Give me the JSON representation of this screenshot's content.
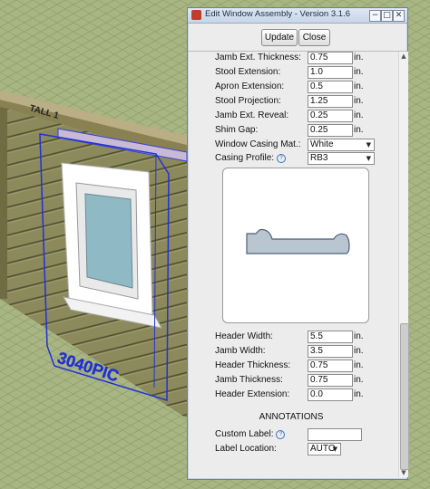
{
  "scene": {
    "model_label": "3040PIC",
    "wall_label": "TALL 1"
  },
  "dialog": {
    "title": "Edit Window Assembly - Version 3.1.6",
    "minimize": "−",
    "maximize": "□",
    "close": "✕",
    "update_label": "Update",
    "close_label": "Close"
  },
  "fields_top": [
    {
      "label": "Jamb Ext. Thickness:",
      "value": "0.75",
      "unit": "in."
    },
    {
      "label": "Stool Extension:",
      "value": "1.0",
      "unit": "in."
    },
    {
      "label": "Apron Extension:",
      "value": "0.5",
      "unit": "in."
    },
    {
      "label": "Stool Projection:",
      "value": "1.25",
      "unit": "in."
    },
    {
      "label": "Jamb Ext. Reveal:",
      "value": "0.25",
      "unit": "in."
    },
    {
      "label": "Shim Gap:",
      "value": "0.25",
      "unit": "in."
    }
  ],
  "casing_material": {
    "label": "Window Casing Mat.:",
    "value": "White"
  },
  "casing_profile": {
    "label": "Casing Profile:",
    "value": "RB3"
  },
  "fields_bottom": [
    {
      "label": "Header Width:",
      "value": "5.5",
      "unit": "in."
    },
    {
      "label": "Jamb Width:",
      "value": "3.5",
      "unit": "in."
    },
    {
      "label": "Header Thickness:",
      "value": "0.75",
      "unit": "in."
    },
    {
      "label": "Jamb Thickness:",
      "value": "0.75",
      "unit": "in."
    },
    {
      "label": "Header Extension:",
      "value": "0.0",
      "unit": "in."
    }
  ],
  "annotations": {
    "heading": "ANNOTATIONS",
    "custom_label": "Custom Label:",
    "custom_value": "",
    "location_label": "Label Location:",
    "location_value": "AUTO"
  }
}
